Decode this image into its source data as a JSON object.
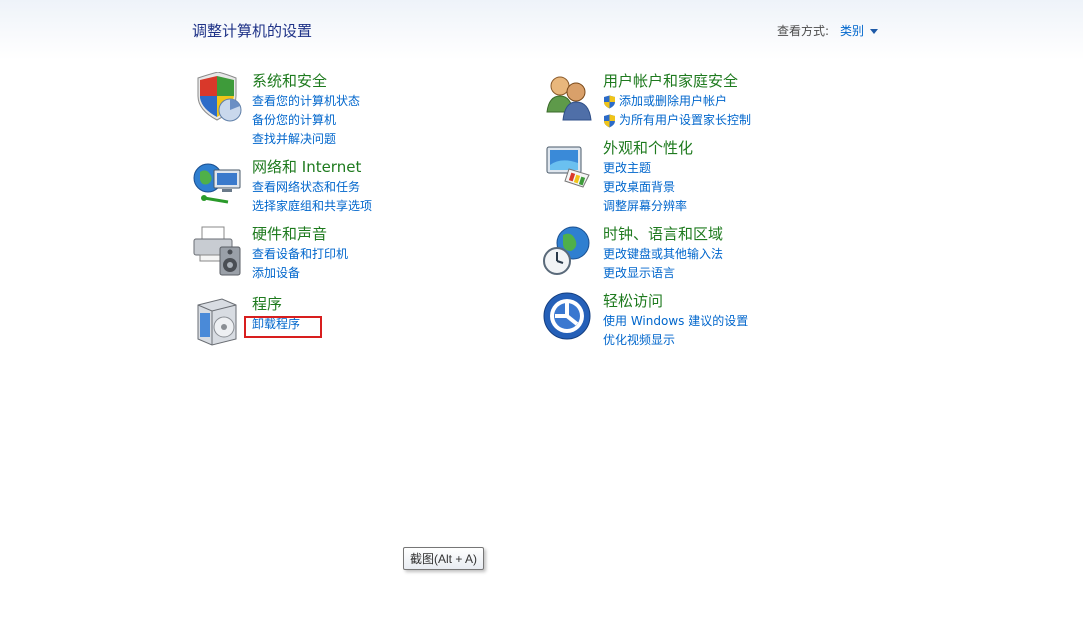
{
  "header": {
    "title": "调整计算机的设置",
    "view_by_label": "查看方式:",
    "view_by_value": "类别"
  },
  "categories": {
    "system": {
      "icon": "shield-security-icon",
      "title": "系统和安全",
      "links": [
        "查看您的计算机状态",
        "备份您的计算机",
        "查找并解决问题"
      ]
    },
    "user": {
      "icon": "users-icon",
      "title": "用户帐户和家庭安全",
      "links": [
        "添加或删除用户帐户",
        "为所有用户设置家长控制"
      ]
    },
    "network": {
      "icon": "network-globe-icon",
      "title": "网络和 Internet",
      "links": [
        "查看网络状态和任务",
        "选择家庭组和共享选项"
      ]
    },
    "appearance": {
      "icon": "monitor-palette-icon",
      "title": "外观和个性化",
      "links": [
        "更改主题",
        "更改桌面背景",
        "调整屏幕分辨率"
      ]
    },
    "hardware": {
      "icon": "printer-speaker-icon",
      "title": "硬件和声音",
      "links": [
        "查看设备和打印机",
        "添加设备"
      ]
    },
    "clock": {
      "icon": "clock-globe-icon",
      "title": "时钟、语言和区域",
      "links": [
        "更改键盘或其他输入法",
        "更改显示语言"
      ]
    },
    "programs": {
      "icon": "programs-box-icon",
      "title": "程序",
      "links": [
        "卸载程序"
      ]
    },
    "ease": {
      "icon": "ease-of-access-icon",
      "title": "轻松访问",
      "links": [
        "使用 Windows 建议的设置",
        "优化视频显示"
      ]
    }
  },
  "tooltip": {
    "text": "截图(Alt + A)"
  },
  "colors": {
    "title": "#1e3287",
    "category_title": "#1e7a1e",
    "link": "#0066cc",
    "highlight": "#d81e1e"
  }
}
